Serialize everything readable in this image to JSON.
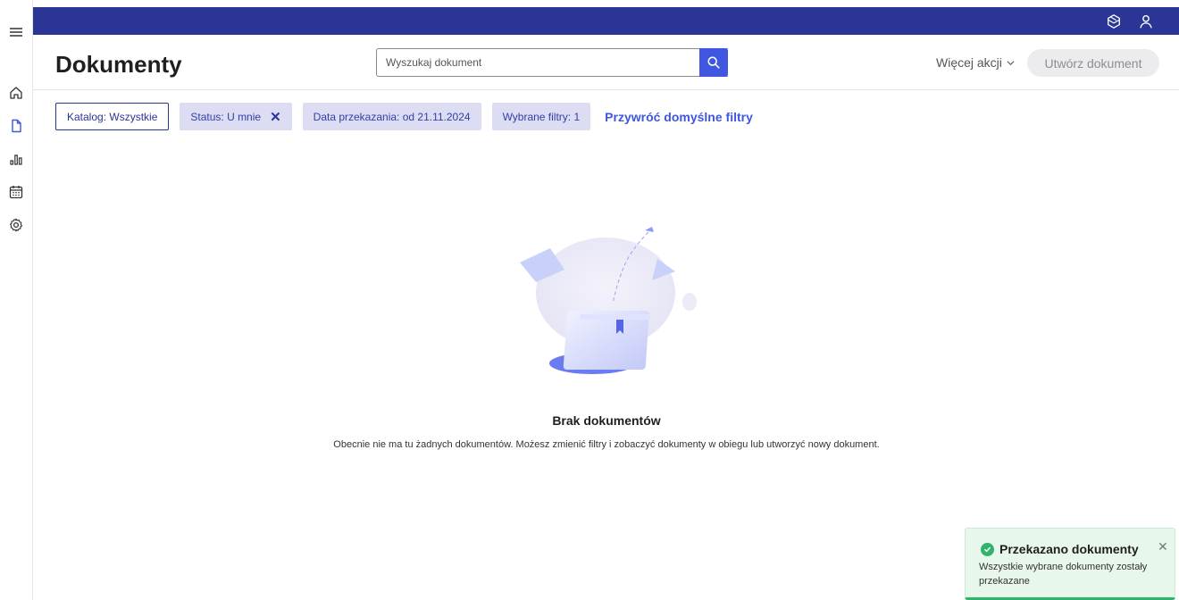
{
  "app": {
    "page_title": "Dokumenty"
  },
  "search": {
    "placeholder": "Wyszukaj dokument"
  },
  "header": {
    "more_actions_label": "Więcej akcji",
    "create_label": "Utwórz dokument"
  },
  "filters": {
    "catalog_label": "Katalog: Wszystkie",
    "status_label": "Status: U mnie",
    "date_label": "Data przekazania: od 21.11.2024",
    "selected_label": "Wybrane filtry: 1",
    "reset_label": "Przywróć domyślne filtry"
  },
  "empty": {
    "title": "Brak dokumentów",
    "description": "Obecnie nie ma tu żadnych dokumentów. Możesz zmienić filtry i zobaczyć dokumenty w obiegu lub utworzyć nowy dokument."
  },
  "toast": {
    "title": "Przekazano dokumenty",
    "message": "Wszystkie wybrane dokumenty zostały przekazane"
  },
  "colors": {
    "topbar": "#2b3595",
    "accent": "#3f56e0",
    "chip_bg": "#dcdcf3",
    "success": "#2fb46a"
  },
  "icons": {
    "rail": [
      "menu-icon",
      "home-icon",
      "document-icon",
      "chart-icon",
      "calendar-icon",
      "settings-icon"
    ],
    "topbar": [
      "assistant-icon",
      "user-icon"
    ]
  }
}
